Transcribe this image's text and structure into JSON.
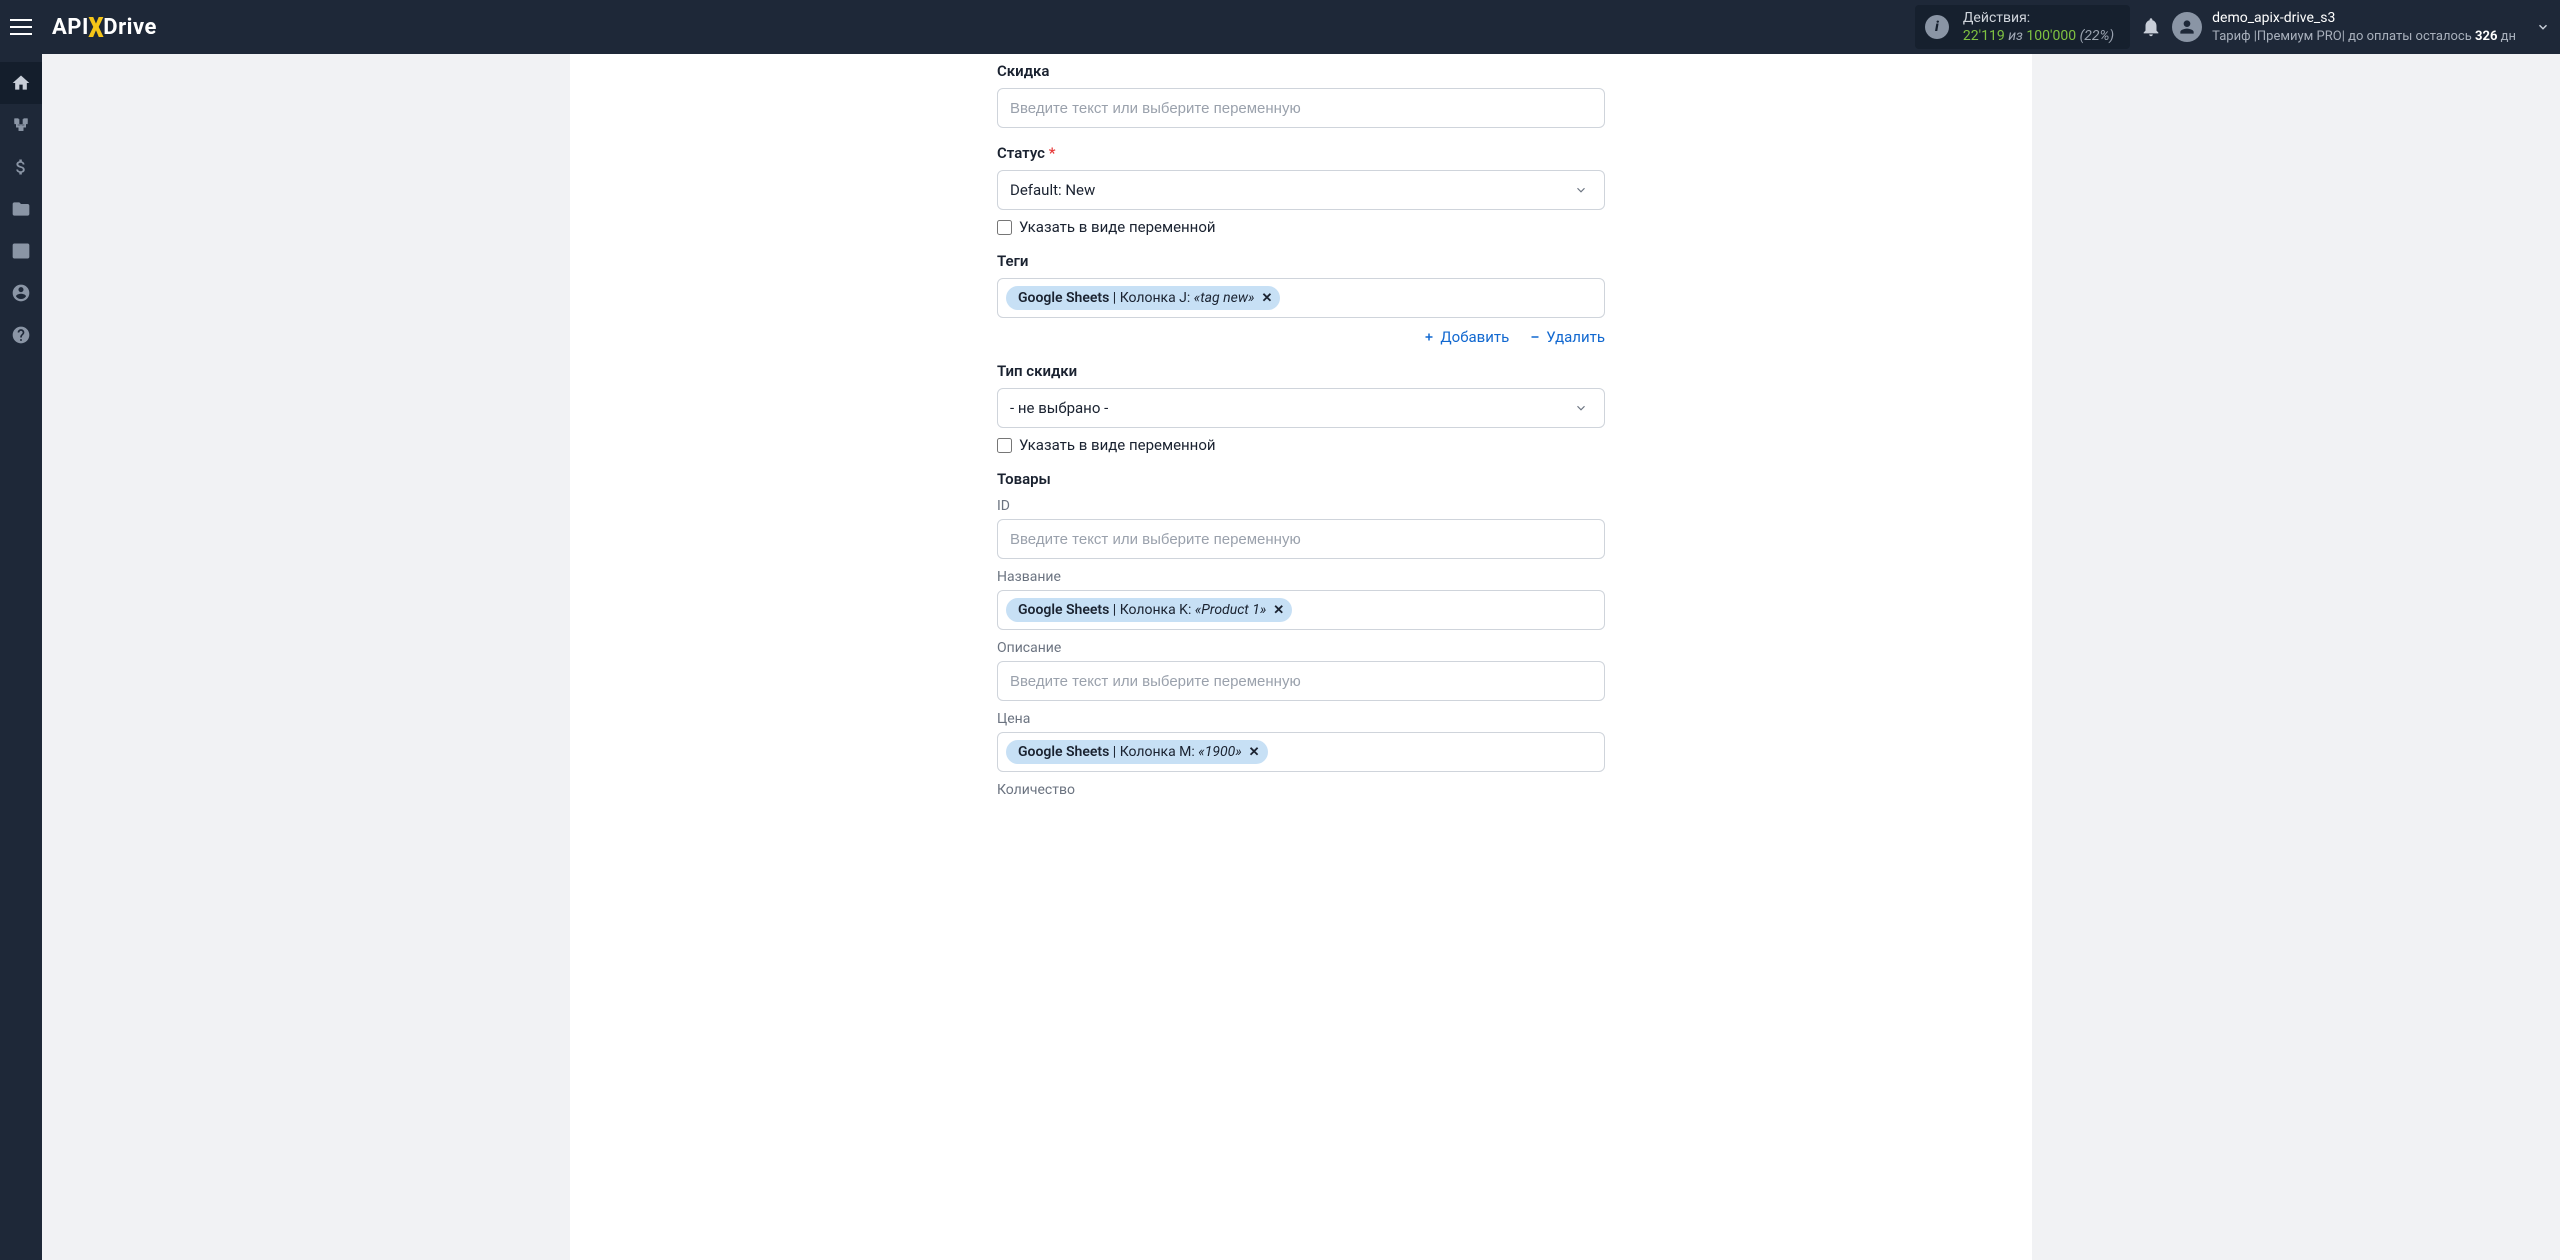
{
  "header": {
    "logo_api": "API",
    "logo_drive": "Drive",
    "actions": {
      "label": "Действия:",
      "count": "22'119",
      "of": "из",
      "limit": "100'000",
      "pct": "(22%)"
    },
    "user": {
      "name": "demo_apix-drive_s3",
      "tariff_prefix": "Тариф |",
      "tariff_plan": "Премиум PRO",
      "tariff_mid": "| до оплаты осталось ",
      "days": "326",
      "days_suffix": " дн"
    }
  },
  "form": {
    "discount_label": "Скидка",
    "input_placeholder": "Введите текст или выберите переменную",
    "status_label": "Статус",
    "status_value": "Default: New",
    "as_variable": "Указать в виде переменной",
    "tags_label": "Теги",
    "tags_chip": {
      "source": "Google Sheets",
      "column": " | Колонка J: ",
      "value": "«tag new»"
    },
    "add_link": "Добавить",
    "delete_link": "Удалить",
    "discount_type_label": "Тип скидки",
    "discount_type_value": "- не выбрано -",
    "products_heading": "Товары",
    "product_id_label": "ID",
    "product_name_label": "Название",
    "product_name_chip": {
      "source": "Google Sheets",
      "column": " | Колонка K: ",
      "value": "«Product 1»"
    },
    "product_desc_label": "Описание",
    "product_price_label": "Цена",
    "product_price_chip": {
      "source": "Google Sheets",
      "column": " | Колонка M: ",
      "value": "«1900»"
    },
    "product_qty_label": "Количество"
  }
}
